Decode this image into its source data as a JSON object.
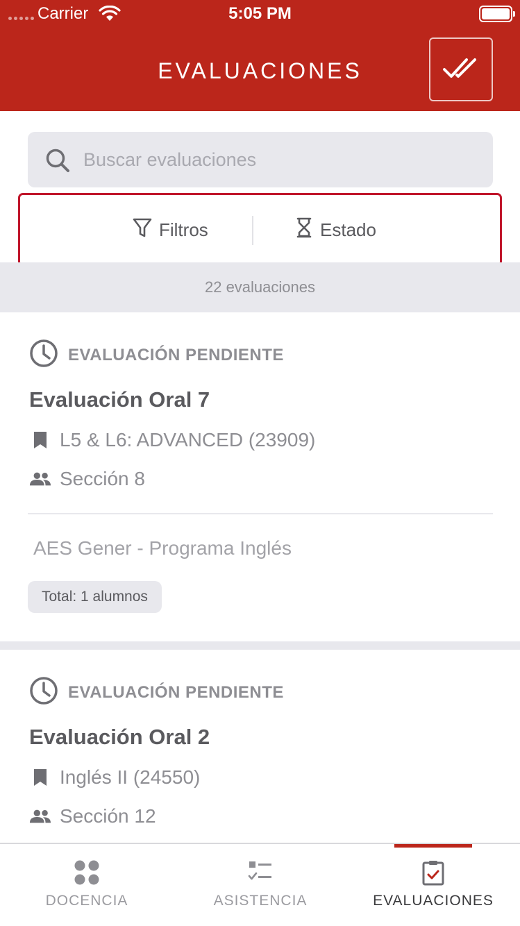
{
  "status_bar": {
    "carrier": "Carrier",
    "time": "5:05 PM"
  },
  "header": {
    "title": "EVALUACIONES",
    "action_icon": "double-check-icon"
  },
  "search": {
    "placeholder": "Buscar evaluaciones",
    "value": ""
  },
  "filters": {
    "filters_label": "Filtros",
    "status_label": "Estado"
  },
  "results": {
    "count_label": "22 evaluaciones"
  },
  "evaluations": [
    {
      "status": "EVALUACIÓN PENDIENTE",
      "title": "Evaluación Oral 7",
      "course": "L5 & L6: ADVANCED (23909)",
      "section": "Sección 8",
      "program": "AES Gener - Programa Inglés",
      "total": "Total: 1 alumnos"
    },
    {
      "status": "EVALUACIÓN PENDIENTE",
      "title": "Evaluación Oral 2",
      "course": "Inglés II (24550)",
      "section": "Sección 12"
    }
  ],
  "tabs": [
    {
      "label": "DOCENCIA",
      "icon": "grid-dots-icon",
      "active": false
    },
    {
      "label": "ASISTENCIA",
      "icon": "checklist-icon",
      "active": false
    },
    {
      "label": "EVALUACIONES",
      "icon": "clipboard-check-icon",
      "active": true
    }
  ],
  "colors": {
    "brand": "#bb261b",
    "highlight_border": "#c0162b",
    "muted_bg": "#e8e8ed"
  }
}
